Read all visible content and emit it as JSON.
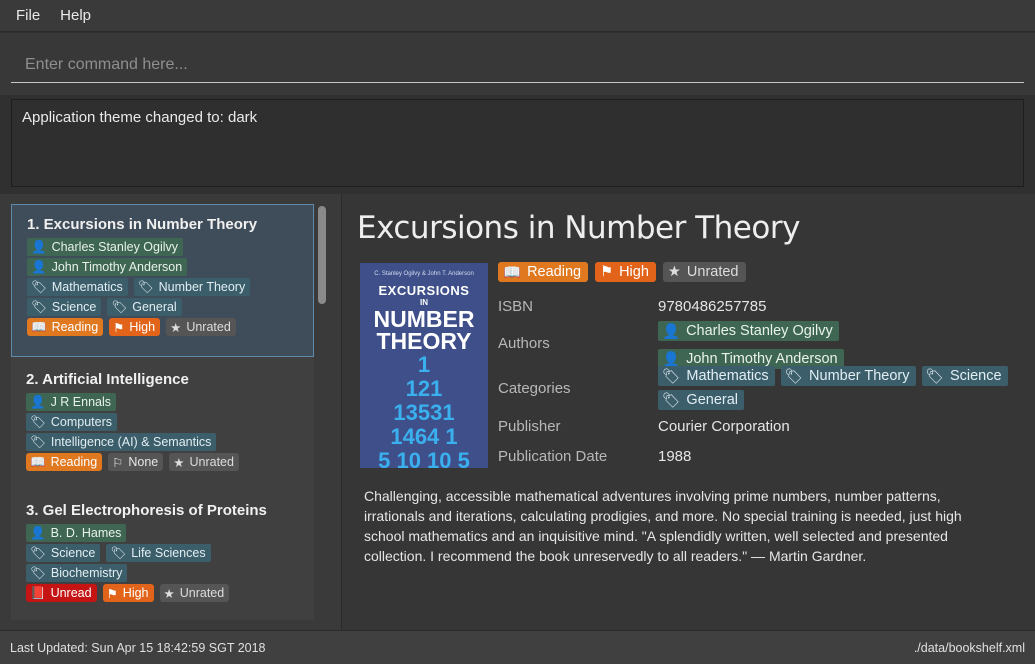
{
  "menu": {
    "file": "File",
    "help": "Help"
  },
  "command": {
    "placeholder": "Enter command here..."
  },
  "result": {
    "message": "Application theme changed to: dark"
  },
  "icons": {
    "author": "person-icon",
    "category": "tag-icon",
    "reading": "open-book-icon",
    "unread": "closed-book-icon",
    "priority": "flag-icon",
    "rating": "star-icon"
  },
  "books": [
    {
      "title": "1. Excursions in Number Theory",
      "authors": [
        "Charles Stanley Ogilvy",
        "John Timothy Anderson"
      ],
      "categories": [
        "Mathematics",
        "Number Theory",
        "Science",
        "General"
      ],
      "status": "Reading",
      "priority": "High",
      "rating": "Unrated"
    },
    {
      "title": "2. Artificial Intelligence",
      "authors": [
        "J R Ennals"
      ],
      "categories": [
        "Computers",
        "Intelligence (AI) & Semantics"
      ],
      "status": "Reading",
      "priority": "None",
      "rating": "Unrated"
    },
    {
      "title": "3. Gel Electrophoresis of Proteins",
      "authors": [
        "B. D. Hames"
      ],
      "categories": [
        "Science",
        "Life Sciences",
        "Biochemistry"
      ],
      "status": "Unread",
      "priority": "High",
      "rating": "Unrated"
    }
  ],
  "detail": {
    "title": "Excursions in Number Theory",
    "status": "Reading",
    "priority": "High",
    "rating": "Unrated",
    "cover": {
      "authors": "C. Stanley Ogilvy & John T. Anderson",
      "line1": "EXCURSIONS",
      "line2": "IN",
      "line3": "NUMBER",
      "line4": "THEORY",
      "digits": [
        "1",
        "121",
        "13531",
        "1464 1",
        "5 10 10 5"
      ]
    },
    "labels": {
      "isbn": "ISBN",
      "authors": "Authors",
      "categories": "Categories",
      "publisher": "Publisher",
      "publication_date": "Publication Date"
    },
    "isbn": "9780486257785",
    "authors": [
      "Charles Stanley Ogilvy",
      "John Timothy Anderson"
    ],
    "categories": [
      "Mathematics",
      "Number Theory",
      "Science",
      "General"
    ],
    "publisher": "Courier Corporation",
    "publication_date": "1988",
    "description": "Challenging, accessible mathematical adventures involving prime numbers, number patterns, irrationals and iterations, calculating prodigies, and more. No special training is needed, just high school mathematics and an inquisitive mind. \"A splendidly written, well selected and presented collection. I recommend the book unreservedly to all readers.\" — Martin Gardner."
  },
  "status_bar": {
    "last_updated": "Last Updated: Sun Apr 15 18:42:59 SGT 2018",
    "file_path": "./data/bookshelf.xml"
  },
  "colors": {
    "reading": "#e07820",
    "unread": "#c41414",
    "priority_high": "#e2641a",
    "author_chip": "#3e6652",
    "category_chip": "#3c5d6a",
    "selection": "#3f4c5a"
  }
}
